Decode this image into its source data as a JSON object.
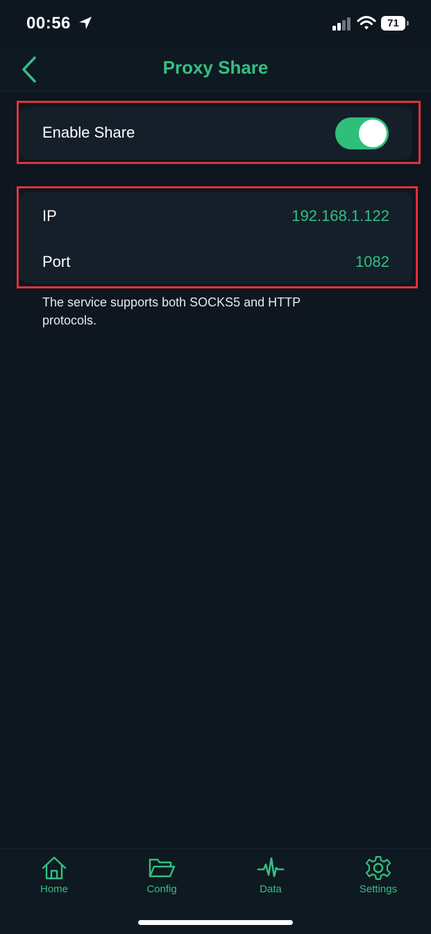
{
  "status_bar": {
    "time": "00:56",
    "battery": "71",
    "icons": [
      "location-arrow-icon",
      "cellular-signal-icon",
      "wifi-icon",
      "battery-icon"
    ]
  },
  "nav": {
    "title": "Proxy Share",
    "back_icon": "chevron-left-icon"
  },
  "share_toggle": {
    "label": "Enable Share",
    "enabled": true
  },
  "info": {
    "ip_label": "IP",
    "ip_value": "192.168.1.122",
    "port_label": "Port",
    "port_value": "1082"
  },
  "footnote": "The service supports both SOCKS5 and HTTP protocols.",
  "tabs": [
    {
      "label": "Home",
      "icon": "home-icon"
    },
    {
      "label": "Config",
      "icon": "folder-icon"
    },
    {
      "label": "Data",
      "icon": "pulse-icon"
    },
    {
      "label": "Settings",
      "icon": "gear-icon"
    }
  ],
  "colors": {
    "background": "#0e1620",
    "card": "#141f2a",
    "accent": "#33c07f",
    "highlight": "#e0333d"
  }
}
